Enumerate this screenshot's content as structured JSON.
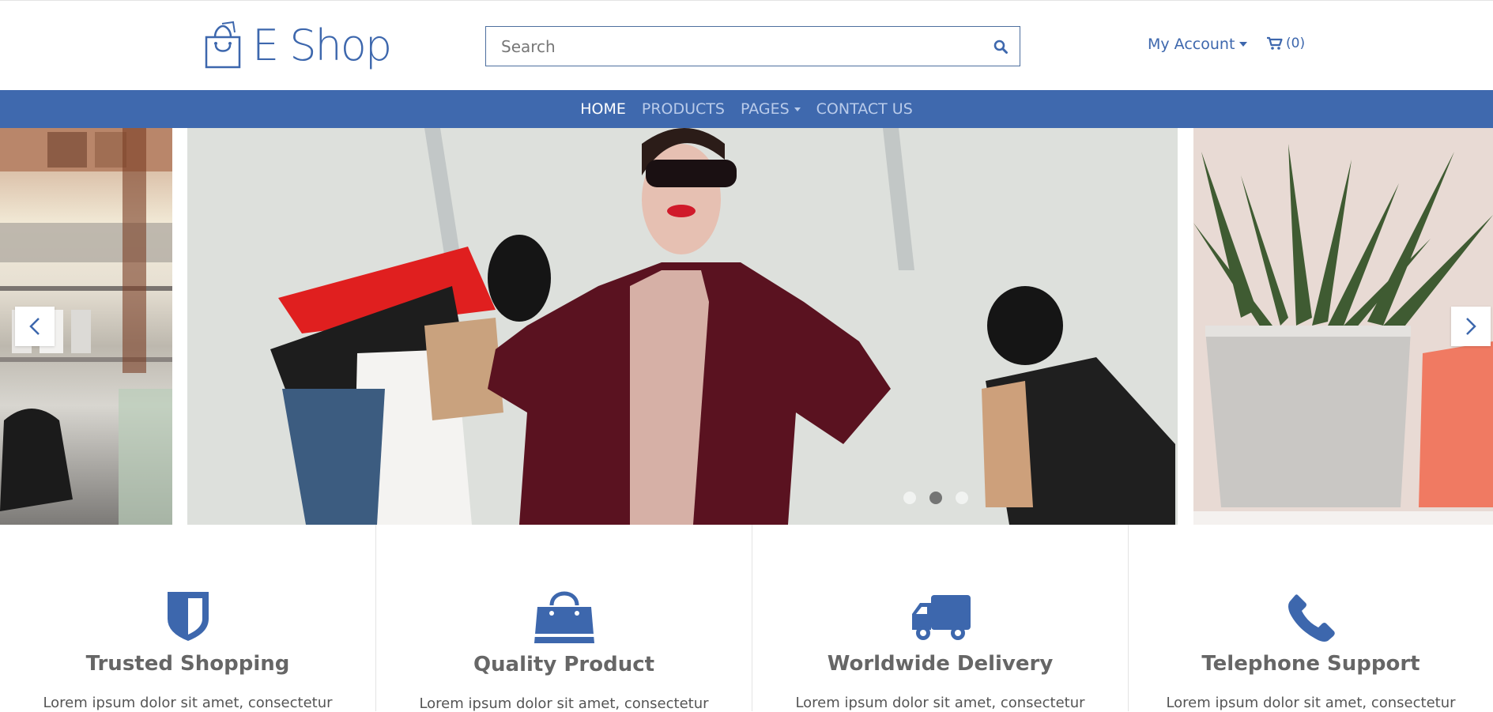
{
  "header": {
    "logo_text": "E Shop",
    "search": {
      "placeholder": "Search",
      "value": ""
    },
    "account_label": "My Account",
    "cart_count_label": "(0)"
  },
  "nav": {
    "items": [
      {
        "label": "HOME",
        "active": true
      },
      {
        "label": "PRODUCTS",
        "active": false
      },
      {
        "label": "PAGES",
        "active": false,
        "dropdown": true
      },
      {
        "label": "CONTACT US",
        "active": false
      }
    ]
  },
  "carousel": {
    "slides": [
      {
        "icon": "store-interior"
      },
      {
        "icon": "woman-with-shopping-bags"
      },
      {
        "icon": "potted-plant"
      }
    ],
    "active_index": 1
  },
  "features": [
    {
      "icon": "shield-icon",
      "title": "Trusted Shopping",
      "description": "Lorem ipsum dolor sit amet, consectetur"
    },
    {
      "icon": "shopping-bag-icon",
      "title": "Quality Product",
      "description": "Lorem ipsum dolor sit amet, consectetur"
    },
    {
      "icon": "truck-icon",
      "title": "Worldwide Delivery",
      "description": "Lorem ipsum dolor sit amet, consectetur"
    },
    {
      "icon": "phone-icon",
      "title": "Telephone Support",
      "description": "Lorem ipsum dolor sit amet, consectetur"
    }
  ],
  "colors": {
    "brand": "#3f69ae",
    "nav_inactive": "#b9cbea",
    "text": "#555555"
  }
}
